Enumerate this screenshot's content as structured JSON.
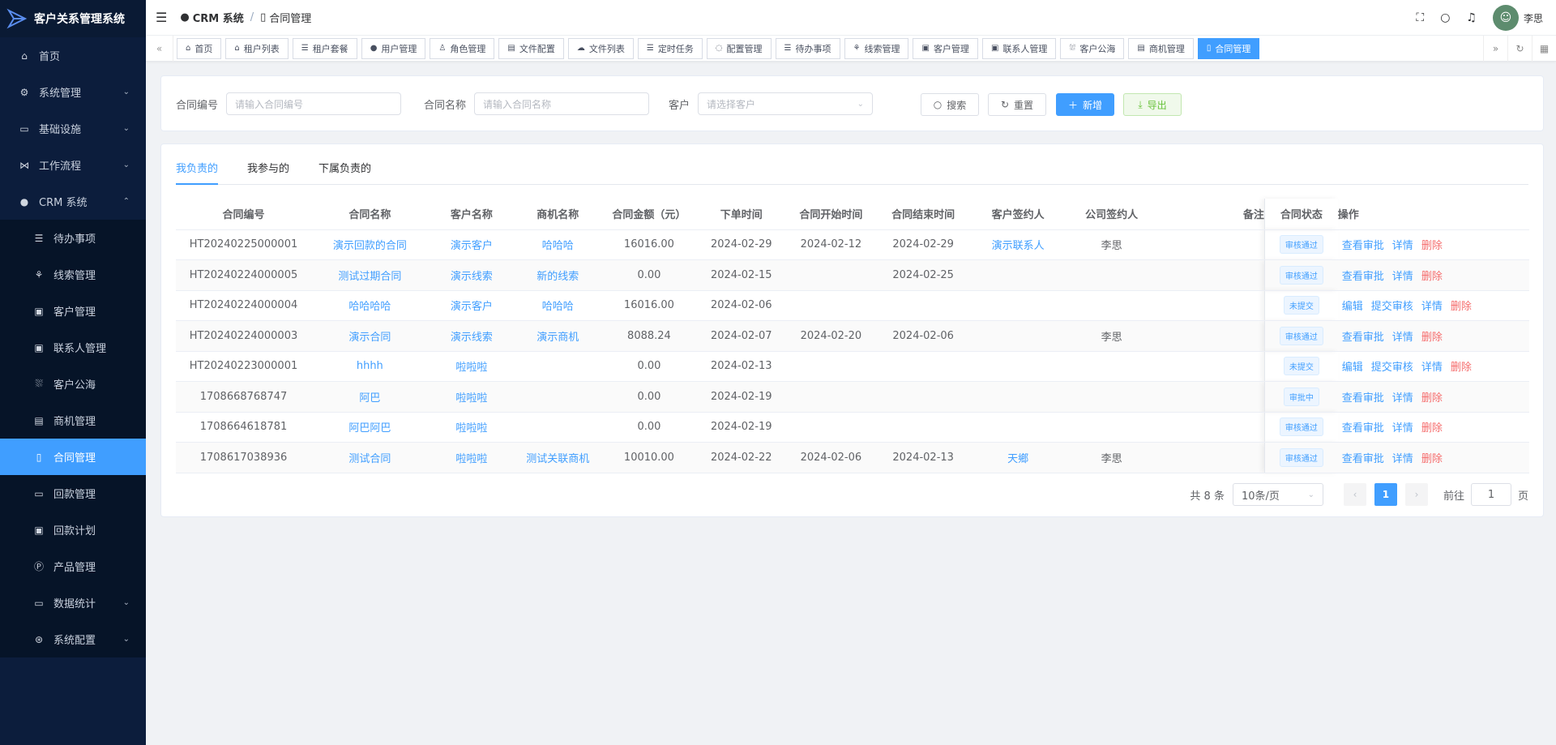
{
  "app_title": "客户关系管理系统",
  "sidebar": {
    "items": [
      {
        "icon": "home-icon",
        "label": "首页"
      },
      {
        "icon": "gear-icon",
        "label": "系统管理"
      },
      {
        "icon": "monitor-icon",
        "label": "基础设施"
      },
      {
        "icon": "workflow-icon",
        "label": "工作流程"
      },
      {
        "icon": "user-icon",
        "label": "CRM 系统"
      }
    ],
    "sub_items": [
      {
        "icon": "list-icon",
        "label": "待办事项"
      },
      {
        "icon": "clue-icon",
        "label": "线索管理"
      },
      {
        "icon": "customer-icon",
        "label": "客户管理"
      },
      {
        "icon": "contact-icon",
        "label": "联系人管理"
      },
      {
        "icon": "sea-icon",
        "label": "客户公海"
      },
      {
        "icon": "bus-icon",
        "label": "商机管理"
      },
      {
        "icon": "contract-icon",
        "label": "合同管理"
      },
      {
        "icon": "payment-icon",
        "label": "回款管理"
      },
      {
        "icon": "plan-icon",
        "label": "回款计划"
      },
      {
        "icon": "product-icon",
        "label": "产品管理"
      },
      {
        "icon": "stats-icon",
        "label": "数据统计"
      },
      {
        "icon": "config-icon",
        "label": "系统配置"
      }
    ]
  },
  "navbar": {
    "breadcrumb_root": "CRM 系统",
    "breadcrumb_current": "合同管理",
    "user_name": "李思"
  },
  "tags": [
    "首页",
    "租户列表",
    "租户套餐",
    "用户管理",
    "角色管理",
    "文件配置",
    "文件列表",
    "定时任务",
    "配置管理",
    "待办事项",
    "线索管理",
    "客户管理",
    "联系人管理",
    "客户公海",
    "商机管理",
    "合同管理"
  ],
  "search": {
    "contract_no_label": "合同编号",
    "contract_no_placeholder": "请输入合同编号",
    "contract_name_label": "合同名称",
    "contract_name_placeholder": "请输入合同名称",
    "customer_label": "客户",
    "customer_placeholder": "请选择客户",
    "search_btn": "搜索",
    "reset_btn": "重置",
    "add_btn": "新增",
    "export_btn": "导出"
  },
  "tabs": [
    "我负责的",
    "我参与的",
    "下属负责的"
  ],
  "table": {
    "headers": [
      "合同编号",
      "合同名称",
      "客户名称",
      "商机名称",
      "合同金额（元）",
      "下单时间",
      "合同开始时间",
      "合同结束时间",
      "客户签约人",
      "公司签约人",
      "备注",
      "合同状态",
      "操作"
    ],
    "rows": [
      {
        "no": "HT20240225000001",
        "name": "演示回款的合同",
        "customer": "演示客户",
        "biz": "哈哈哈",
        "amount": "16016.00",
        "order": "2024-02-29",
        "start": "2024-02-12",
        "end": "2024-02-29",
        "csign": "演示联系人",
        "psign": "李思",
        "remark": "",
        "status": "审核通过",
        "ops": [
          "查看审批",
          "详情",
          "删除"
        ]
      },
      {
        "no": "HT20240224000005",
        "name": "测试过期合同",
        "customer": "演示线索",
        "biz": "新的线索",
        "amount": "0.00",
        "order": "2024-02-15",
        "start": "",
        "end": "2024-02-25",
        "csign": "",
        "psign": "",
        "remark": "",
        "status": "审核通过",
        "ops": [
          "查看审批",
          "详情",
          "删除"
        ]
      },
      {
        "no": "HT20240224000004",
        "name": "哈哈哈哈",
        "customer": "演示客户",
        "biz": "哈哈哈",
        "amount": "16016.00",
        "order": "2024-02-06",
        "start": "",
        "end": "",
        "csign": "",
        "psign": "",
        "remark": "",
        "status": "未提交",
        "ops": [
          "编辑",
          "提交审核",
          "详情",
          "删除"
        ]
      },
      {
        "no": "HT20240224000003",
        "name": "演示合同",
        "customer": "演示线索",
        "biz": "演示商机",
        "amount": "8088.24",
        "order": "2024-02-07",
        "start": "2024-02-20",
        "end": "2024-02-06",
        "csign": "",
        "psign": "李思",
        "remark": "",
        "status": "审核通过",
        "ops": [
          "查看审批",
          "详情",
          "删除"
        ]
      },
      {
        "no": "HT20240223000001",
        "name": "hhhh",
        "customer": "啦啦啦",
        "biz": "",
        "amount": "0.00",
        "order": "2024-02-13",
        "start": "",
        "end": "",
        "csign": "",
        "psign": "",
        "remark": "",
        "status": "未提交",
        "ops": [
          "编辑",
          "提交审核",
          "详情",
          "删除"
        ]
      },
      {
        "no": "1708668768747",
        "name": "阿巴",
        "customer": "啦啦啦",
        "biz": "",
        "amount": "0.00",
        "order": "2024-02-19",
        "start": "",
        "end": "",
        "csign": "",
        "psign": "",
        "remark": "",
        "status": "审批中",
        "ops": [
          "查看审批",
          "详情",
          "删除"
        ]
      },
      {
        "no": "1708664618781",
        "name": "阿巴阿巴",
        "customer": "啦啦啦",
        "biz": "",
        "amount": "0.00",
        "order": "2024-02-19",
        "start": "",
        "end": "",
        "csign": "",
        "psign": "",
        "remark": "",
        "status": "审核通过",
        "ops": [
          "查看审批",
          "详情",
          "删除"
        ]
      },
      {
        "no": "1708617038936",
        "name": "测试合同",
        "customer": "啦啦啦",
        "biz": "测试关联商机",
        "amount": "10010.00",
        "order": "2024-02-22",
        "start": "2024-02-06",
        "end": "2024-02-13",
        "csign": "天鄉",
        "psign": "李思",
        "remark": "",
        "status": "审核通过",
        "ops": [
          "查看审批",
          "详情",
          "删除"
        ]
      }
    ]
  },
  "pagination": {
    "total": "共 8 条",
    "page_size": "10条/页",
    "current": "1",
    "goto_label": "前往",
    "goto_value": "1",
    "page_suffix": "页"
  },
  "colors": {
    "primary": "#409eff",
    "sidebar": "#0c1d3c",
    "danger": "#f56c6c"
  }
}
